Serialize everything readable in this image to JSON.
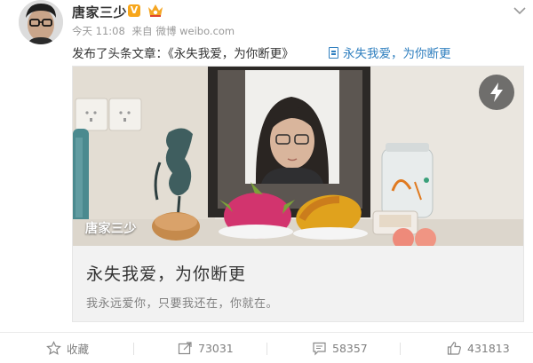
{
  "post": {
    "author_name": "唐家三少",
    "verified_badge": "V",
    "time": "今天 11:08",
    "source_prefix": "来自",
    "source": "微博 weibo.com",
    "text_prefix": "发布了头条文章：",
    "article_link_quoted": "《永失我爱，为你断更》",
    "article_link_text": "永失我爱，为你断更"
  },
  "article_card": {
    "cover_caption": "唐家三少",
    "title": "永失我爱，为你断更",
    "subtitle": "我永远爱你，只要我还在，你就在。"
  },
  "toolbar": {
    "favorite_label": "收藏",
    "repost_count": "73031",
    "comment_count": "58357",
    "like_count": "431813"
  },
  "icons": {
    "crown_badge": "member-crown-icon",
    "top_arrow": "chevron-down-icon",
    "flash": "lightning-icon",
    "favorite": "star-icon",
    "repost": "repost-icon",
    "comment": "comment-icon",
    "like": "thumbs-up-icon"
  },
  "colors": {
    "accent_link": "#eb7350",
    "article_link": "#2f7fbf",
    "verified_badge": "#f7a61a",
    "muted_text": "#808080"
  }
}
